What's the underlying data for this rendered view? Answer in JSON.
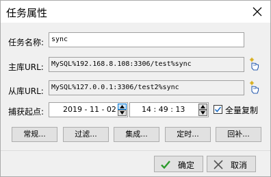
{
  "window": {
    "title": "任务属性"
  },
  "form": {
    "task_name_label": "任务名称:",
    "task_name_value": "sync",
    "main_url_label": "主库URL:",
    "main_url_value": "MySQL%192.168.8.108:3306/test%sync",
    "slave_url_label": "从库URL:",
    "slave_url_value": "MySQL%127.0.0.1:3306/test2%sync",
    "capture_label": "捕获起点:",
    "date_value": "2019 - 11 - 02",
    "time_value": "14 : 49 : 13",
    "full_copy_label": "全量复制",
    "full_copy_checked": true
  },
  "buttons": {
    "general": "常规...",
    "filter": "过滤...",
    "integration": "集成...",
    "timer": "定时...",
    "supplement": "回补...",
    "ok": "确定",
    "cancel": "取消"
  },
  "icons": {
    "close": "close-icon",
    "main_url_picker": "hand-pointer-icon",
    "slave_url_picker": "hand-pointer-icon",
    "ok": "checkmark-icon",
    "cancel": "x-icon"
  },
  "colors": {
    "accent": "#0078d7",
    "check": "#1e6ec8",
    "ok_icon": "#2a9a2a"
  }
}
